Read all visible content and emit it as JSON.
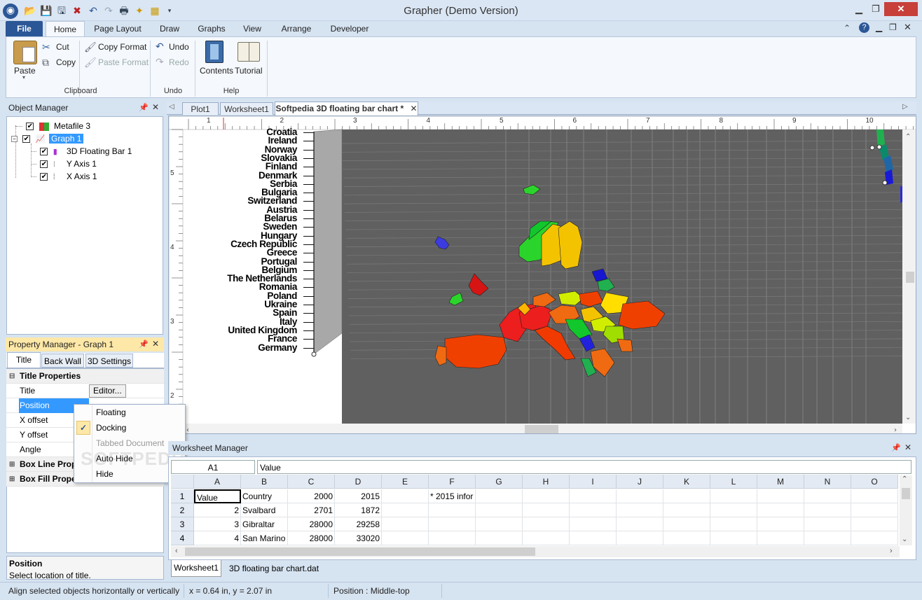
{
  "window": {
    "title": "Grapher (Demo Version)"
  },
  "ribbon_tabs": [
    "File",
    "Home",
    "Page Layout",
    "Draw",
    "Graphs",
    "View",
    "Arrange",
    "Developer"
  ],
  "ribbon": {
    "paste": "Paste",
    "cut": "Cut",
    "copy": "Copy",
    "copy_format": "Copy Format",
    "paste_format": "Paste Format",
    "undo": "Undo",
    "redo": "Redo",
    "contents": "Contents",
    "tutorial": "Tutorial",
    "groups": {
      "clipboard": "Clipboard",
      "undo": "Undo",
      "help": "Help"
    }
  },
  "object_manager": {
    "title": "Object Manager",
    "items": [
      "Metafile 3",
      "Graph 1",
      "3D Floating Bar 1",
      "Y Axis 1",
      "X Axis 1"
    ]
  },
  "property_manager": {
    "title": "Property Manager - Graph 1",
    "tabs": [
      "Title",
      "Back Wall",
      "3D Settings"
    ],
    "group_title": "Title Properties",
    "rows": [
      {
        "name": "Title",
        "value": "Editor..."
      },
      {
        "name": "Position",
        "value": ""
      },
      {
        "name": "X offset",
        "value": ""
      },
      {
        "name": "Y offset",
        "value": ""
      },
      {
        "name": "Angle",
        "value": ""
      }
    ],
    "group_box_line": "Box Line Prop",
    "group_box_fill": "Box Fill Prope",
    "help_title": "Position",
    "help_text": "Select location of title."
  },
  "popup_menu": {
    "items": [
      "Floating",
      "Docking",
      "Tabbed Document",
      "Auto Hide",
      "Hide"
    ],
    "checked_index": 1
  },
  "document_tabs": [
    "Plot1",
    "Worksheet1",
    "Softpedia 3D floating bar chart *"
  ],
  "ruler": {
    "top": [
      "1",
      "2",
      "3",
      "4",
      "5",
      "6",
      "7",
      "8",
      "9",
      "10"
    ],
    "left": [
      "5",
      "4",
      "3",
      "2"
    ]
  },
  "chart": {
    "countries": [
      "Croatia",
      "Ireland",
      "Norway",
      "Slovakia",
      "Finland",
      "Denmark",
      "Serbia",
      "Bulgaria",
      "Switzerland",
      "Austria",
      "Belarus",
      "Sweden",
      "Hungary",
      "Czech Republic",
      "Greece",
      "Portugal",
      "Belgium",
      "The Netherlands",
      "Romania",
      "Poland",
      "Ukraine",
      "Spain",
      "Italy",
      "United Kingdom",
      "France",
      "Germany"
    ]
  },
  "worksheet_manager": {
    "title": "Worksheet Manager",
    "cell_ref": "A1",
    "cell_value": "Value",
    "columns": [
      "A",
      "B",
      "C",
      "D",
      "E",
      "F",
      "G",
      "H",
      "I",
      "J",
      "K",
      "L",
      "M",
      "N",
      "O"
    ],
    "rows": [
      {
        "n": "1",
        "A": "Value",
        "B": "Country",
        "C": "2000",
        "D": "2015",
        "F": "* 2015 infor"
      },
      {
        "n": "2",
        "A": "2",
        "B": "Svalbard",
        "C": "2701",
        "D": "1872",
        "F": ""
      },
      {
        "n": "3",
        "A": "3",
        "B": "Gibraltar",
        "C": "28000",
        "D": "29258",
        "F": ""
      },
      {
        "n": "4",
        "A": "4",
        "B": "San Marino",
        "C": "28000",
        "D": "33020",
        "F": ""
      }
    ],
    "sheet_tabs": [
      "Worksheet1",
      "3D floating bar chart.dat"
    ]
  },
  "status_bar": {
    "hint": "Align selected objects horizontally or vertically",
    "coords": "x = 0.64 in, y = 2.07 in",
    "position": "Position : Middle-top"
  },
  "watermark": "SOFTPEDIA",
  "colors": {
    "accent": "#2b5797",
    "selection": "#3399ff",
    "panel_bg": "#d6e3f1"
  }
}
